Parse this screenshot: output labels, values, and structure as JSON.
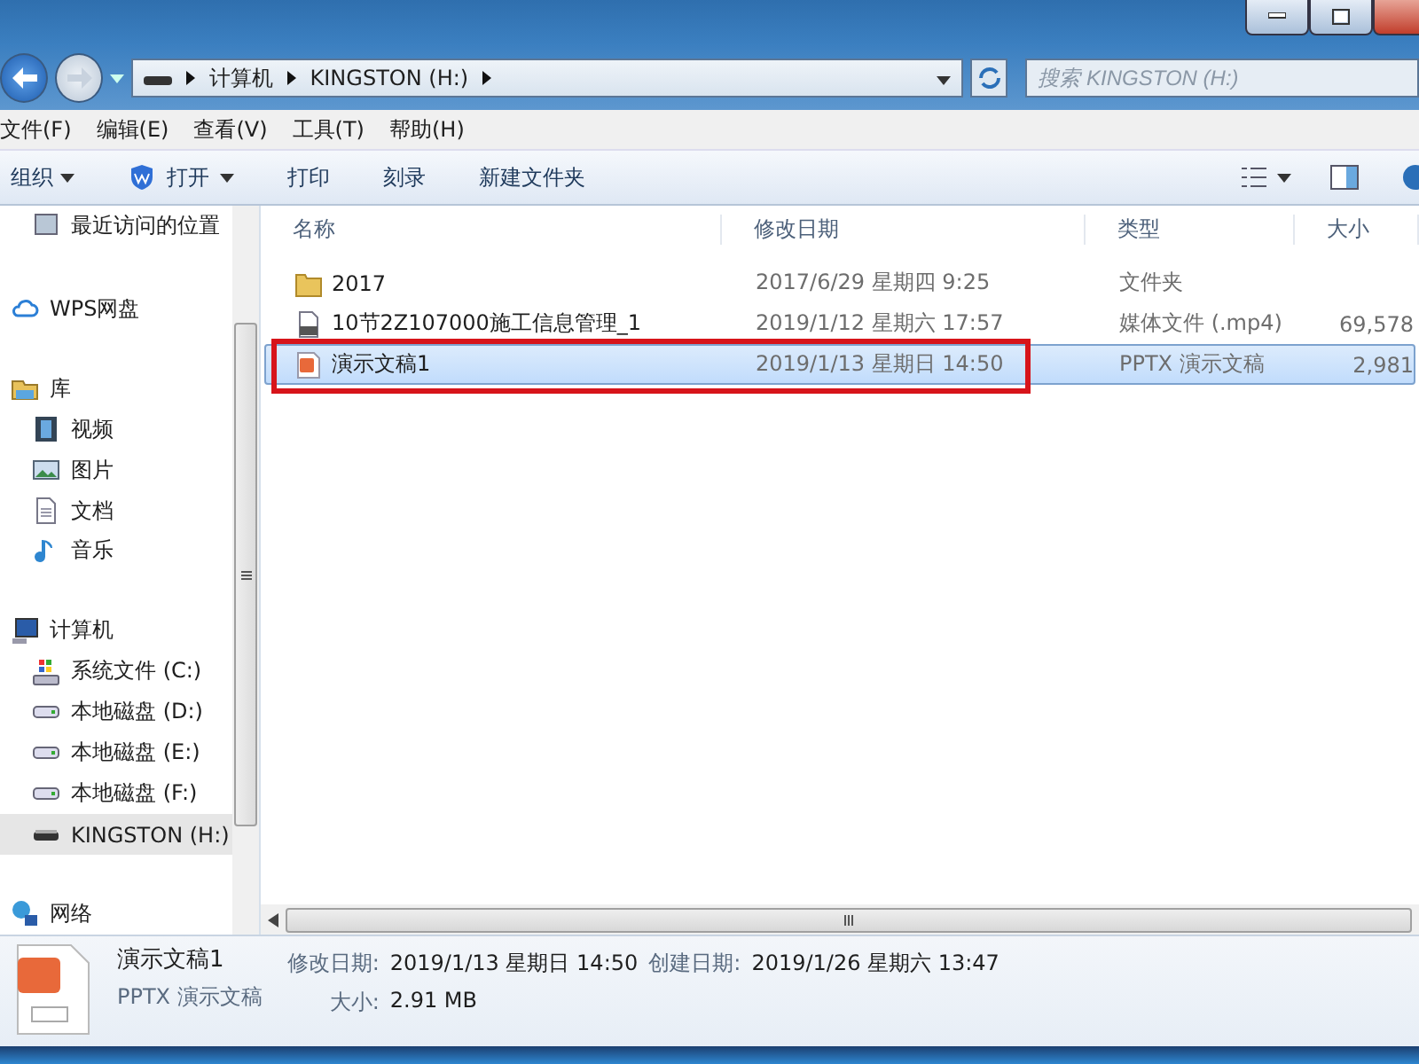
{
  "address": {
    "crumbs": [
      "计算机",
      "KINGSTON (H:)"
    ]
  },
  "search": {
    "placeholder": "搜索 KINGSTON (H:)"
  },
  "menu": [
    "文件(F)",
    "编辑(E)",
    "查看(V)",
    "工具(T)",
    "帮助(H)"
  ],
  "toolbar": [
    {
      "label": "组织",
      "kind": "menu"
    },
    {
      "label": "打开",
      "kind": "app"
    },
    {
      "label": "打印",
      "kind": "plain"
    },
    {
      "label": "刻录",
      "kind": "plain"
    },
    {
      "label": "新建文件夹",
      "kind": "plain"
    }
  ],
  "sidebar": [
    {
      "label": "最近访问的位置",
      "kind": "recent",
      "selected": false
    },
    {
      "label": "WPS网盘",
      "kind": "cloud",
      "selected": false
    },
    {
      "label": "库",
      "kind": "library",
      "selected": false,
      "children": [
        {
          "label": "视频",
          "kind": "video",
          "selected": false
        },
        {
          "label": "图片",
          "kind": "picture",
          "selected": false
        },
        {
          "label": "文档",
          "kind": "document",
          "selected": false
        },
        {
          "label": "音乐",
          "kind": "music",
          "selected": false
        }
      ]
    },
    {
      "label": "计算机",
      "kind": "computer",
      "selected": false,
      "children": [
        {
          "label": "系统文件 (C:)",
          "kind": "system",
          "selected": false
        },
        {
          "label": "本地磁盘 (D:)",
          "kind": "disk",
          "selected": false
        },
        {
          "label": "本地磁盘 (E:)",
          "kind": "disk",
          "selected": false
        },
        {
          "label": "本地磁盘 (F:)",
          "kind": "disk",
          "selected": false
        },
        {
          "label": "KINGSTON (H:)",
          "kind": "usb",
          "selected": true
        }
      ]
    },
    {
      "label": "网络",
      "kind": "network",
      "selected": false
    }
  ],
  "table": {
    "columns": [
      "名称",
      "修改日期",
      "类型",
      "大小"
    ],
    "rows": [
      {
        "name": "2017",
        "date": "2017/6/29 星期四 9:25",
        "type": "文件夹",
        "size": "",
        "kind": "folder",
        "selected": false
      },
      {
        "name": "10节2Z107000施工信息管理_1",
        "date": "2019/1/12 星期六 17:57",
        "type": "媒体文件 (.mp4)",
        "size": "69,578",
        "kind": "video",
        "selected": false
      },
      {
        "name": "演示文稿1",
        "date": "2019/1/13 星期日 14:50",
        "type": "PPTX 演示文稿",
        "size": "2,981",
        "kind": "pptx",
        "selected": true
      }
    ]
  },
  "details": {
    "name": "演示文稿1",
    "type": "PPTX 演示文稿",
    "fields": [
      {
        "label": "修改日期:",
        "value": "2019/1/13 星期日 14:50"
      },
      {
        "label": "创建日期:",
        "value": "2019/1/26 星期六 13:47"
      },
      {
        "label": "大小:",
        "value": "2.91 MB"
      }
    ]
  }
}
